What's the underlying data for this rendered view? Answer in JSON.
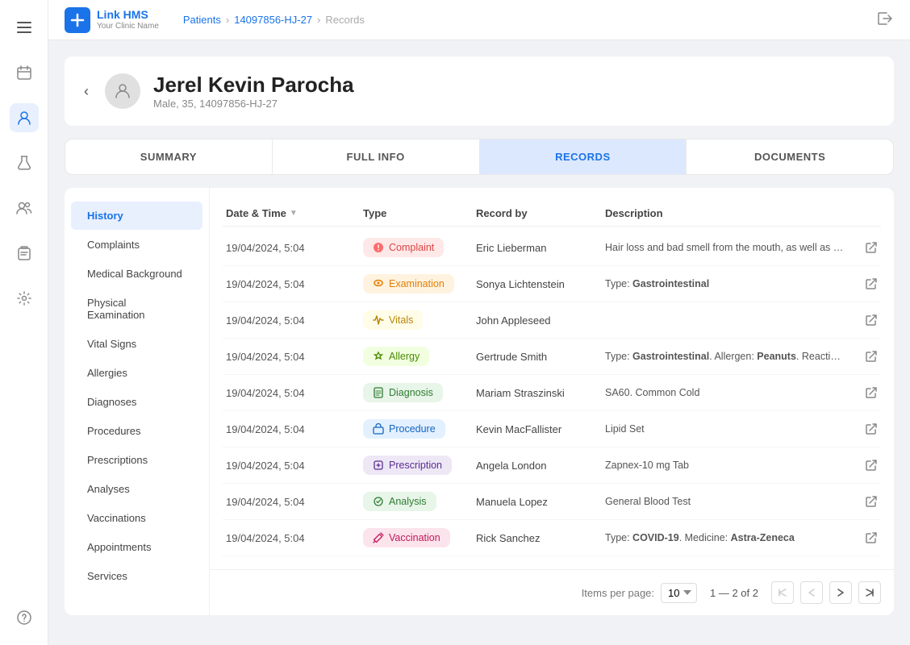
{
  "app": {
    "title": "Link HMS",
    "subtitle": "Your Clinic Name"
  },
  "topnav": {
    "breadcrumb": [
      "Patients",
      "14097856-HJ-27",
      "Records"
    ]
  },
  "patient": {
    "name": "Jerel Kevin Parocha",
    "meta": "Male, 35, 14097856-HJ-27"
  },
  "tabs": [
    {
      "id": "summary",
      "label": "SUMMARY",
      "active": false
    },
    {
      "id": "full_info",
      "label": "FULL INFO",
      "active": false
    },
    {
      "id": "records",
      "label": "RECORDS",
      "active": true
    },
    {
      "id": "documents",
      "label": "DOCUMENTS",
      "active": false
    }
  ],
  "left_nav": {
    "items": [
      {
        "id": "history",
        "label": "History",
        "active": true
      },
      {
        "id": "complaints",
        "label": "Complaints",
        "active": false
      },
      {
        "id": "medical_background",
        "label": "Medical Background",
        "active": false
      },
      {
        "id": "physical_examination",
        "label": "Physical Examination",
        "active": false
      },
      {
        "id": "vital_signs",
        "label": "Vital Signs",
        "active": false
      },
      {
        "id": "allergies",
        "label": "Allergies",
        "active": false
      },
      {
        "id": "diagnoses",
        "label": "Diagnoses",
        "active": false
      },
      {
        "id": "procedures",
        "label": "Procedures",
        "active": false
      },
      {
        "id": "prescriptions",
        "label": "Prescriptions",
        "active": false
      },
      {
        "id": "analyses",
        "label": "Analyses",
        "active": false
      },
      {
        "id": "vaccinations",
        "label": "Vaccinations",
        "active": false
      },
      {
        "id": "appointments",
        "label": "Appointments",
        "active": false
      },
      {
        "id": "services",
        "label": "Services",
        "active": false
      }
    ]
  },
  "table": {
    "columns": [
      {
        "id": "datetime",
        "label": "Date & Time",
        "sortable": true
      },
      {
        "id": "type",
        "label": "Type",
        "sortable": false
      },
      {
        "id": "record_by",
        "label": "Record by",
        "sortable": false
      },
      {
        "id": "description",
        "label": "Description",
        "sortable": false
      }
    ],
    "rows": [
      {
        "datetime": "19/04/2024, 5:04",
        "type": "Complaint",
        "type_class": "complaint",
        "type_icon": "😣",
        "record_by": "Eric Lieberman",
        "description": "Hair loss and bad smell from the mouth, as well as some short tightening and..."
      },
      {
        "datetime": "19/04/2024, 5:04",
        "type": "Examination",
        "type_class": "examination",
        "type_icon": "👁",
        "record_by": "Sonya Lichtenstein",
        "description": "Type: Gastrointestinal"
      },
      {
        "datetime": "19/04/2024, 5:04",
        "type": "Vitals",
        "type_class": "vitals",
        "type_icon": "⚡",
        "record_by": "John Appleseed",
        "description": ""
      },
      {
        "datetime": "19/04/2024, 5:04",
        "type": "Allergy",
        "type_class": "allergy",
        "type_icon": "🏷",
        "record_by": "Gertrude Smith",
        "description": "Type: Gastrointestinal. Allergen: Peanuts. Reaction: Rash, choke"
      },
      {
        "datetime": "19/04/2024, 5:04",
        "type": "Diagnosis",
        "type_class": "diagnosis",
        "type_icon": "📋",
        "record_by": "Mariam Straszinski",
        "description": "SA60. Common Cold"
      },
      {
        "datetime": "19/04/2024, 5:04",
        "type": "Procedure",
        "type_class": "procedure",
        "type_icon": "💊",
        "record_by": "Kevin MacFallister",
        "description": "Lipid Set"
      },
      {
        "datetime": "19/04/2024, 5:04",
        "type": "Prescription",
        "type_class": "prescription",
        "type_icon": "🧴",
        "record_by": "Angela London",
        "description": "Zapnex-10 mg Tab"
      },
      {
        "datetime": "19/04/2024, 5:04",
        "type": "Analysis",
        "type_class": "analysis",
        "type_icon": "🔬",
        "record_by": "Manuela Lopez",
        "description": "General Blood Test"
      },
      {
        "datetime": "19/04/2024, 5:04",
        "type": "Vaccination",
        "type_class": "vaccination",
        "type_icon": "💉",
        "record_by": "Rick Sanchez",
        "description": "Type: COVID-19. Medicine: Astra-Zeneca"
      }
    ]
  },
  "pagination": {
    "items_per_page_label": "Items per page:",
    "items_per_page": "10",
    "range_text": "1 — 2 of 2"
  },
  "sidebar": {
    "icons": [
      {
        "id": "hamburger",
        "symbol": "☰",
        "active": false
      },
      {
        "id": "calendar",
        "symbol": "📅",
        "active": false
      },
      {
        "id": "person",
        "symbol": "👤",
        "active": true
      },
      {
        "id": "flask",
        "symbol": "⚗",
        "active": false
      },
      {
        "id": "group",
        "symbol": "👥",
        "active": false
      },
      {
        "id": "clipboard",
        "symbol": "📋",
        "active": false
      },
      {
        "id": "settings",
        "symbol": "⚙",
        "active": false
      },
      {
        "id": "help",
        "symbol": "❓",
        "active": false
      }
    ]
  }
}
